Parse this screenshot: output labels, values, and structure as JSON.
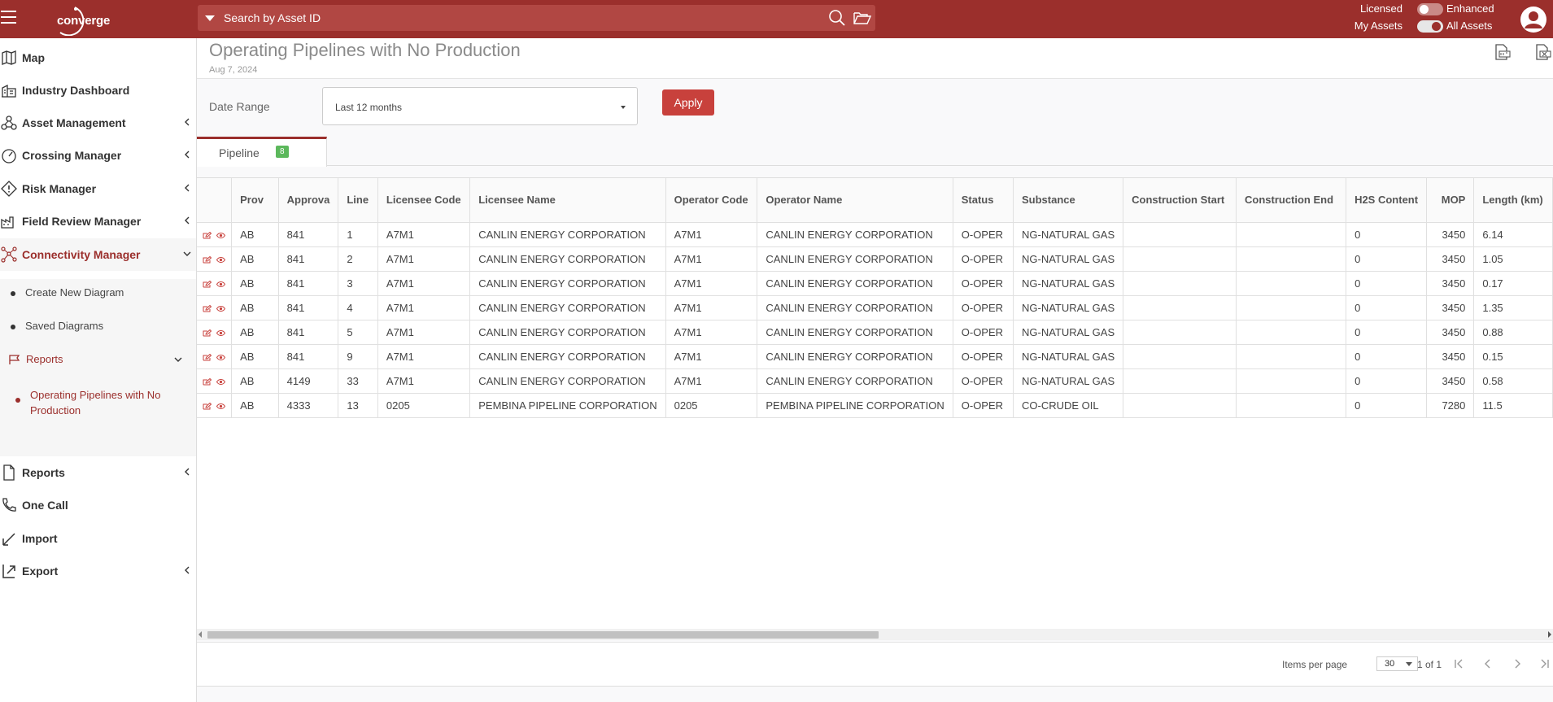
{
  "header": {
    "logo_text": "converge",
    "search_placeholder": "Search by Asset ID",
    "toggle1_left": "Licensed",
    "toggle1_right": "Enhanced",
    "toggle2_left": "My Assets",
    "toggle2_right": "All Assets",
    "accent": "#9b2f2c"
  },
  "sidebar": {
    "map": "Map",
    "industry_dashboard": "Industry Dashboard",
    "asset_management": "Asset Management",
    "crossing_manager": "Crossing Manager",
    "risk_manager": "Risk Manager",
    "field_review_manager": "Field Review Manager",
    "connectivity_manager": "Connectivity Manager",
    "create_new_diagram": "Create New Diagram",
    "saved_diagrams": "Saved Diagrams",
    "reports_sub": "Reports",
    "operating_pipelines": "Operating Pipelines with No Production",
    "reports": "Reports",
    "one_call": "One Call",
    "import": "Import",
    "export": "Export"
  },
  "page": {
    "title": "Operating Pipelines with No Production",
    "date": "Aug 7, 2024",
    "date_range_label": "Date Range",
    "date_range_value": "Last 12 months",
    "apply": "Apply",
    "tab_label": "Pipeline",
    "tab_count": "8"
  },
  "table": {
    "headers": {
      "prov": "Prov",
      "approval": "Approva",
      "line": "Line",
      "licensee_code": "Licensee Code",
      "licensee_name": "Licensee Name",
      "operator_code": "Operator Code",
      "operator_name": "Operator Name",
      "status": "Status",
      "substance": "Substance",
      "construction_start": "Construction Start",
      "construction_end": "Construction End",
      "h2s": "H2S Content",
      "mop": "MOP",
      "length": "Length (km)"
    },
    "rows": [
      {
        "prov": "AB",
        "approval": "841",
        "line": "1",
        "lic_code": "A7M1",
        "lic_name": "CANLIN ENERGY CORPORATION",
        "op_code": "A7M1",
        "op_name": "CANLIN ENERGY CORPORATION",
        "status": "O-OPER",
        "substance": "NG-NATURAL GAS",
        "cstart": "",
        "cend": "",
        "h2s": "0",
        "mop": "3450",
        "length": "6.14"
      },
      {
        "prov": "AB",
        "approval": "841",
        "line": "2",
        "lic_code": "A7M1",
        "lic_name": "CANLIN ENERGY CORPORATION",
        "op_code": "A7M1",
        "op_name": "CANLIN ENERGY CORPORATION",
        "status": "O-OPER",
        "substance": "NG-NATURAL GAS",
        "cstart": "",
        "cend": "",
        "h2s": "0",
        "mop": "3450",
        "length": "1.05"
      },
      {
        "prov": "AB",
        "approval": "841",
        "line": "3",
        "lic_code": "A7M1",
        "lic_name": "CANLIN ENERGY CORPORATION",
        "op_code": "A7M1",
        "op_name": "CANLIN ENERGY CORPORATION",
        "status": "O-OPER",
        "substance": "NG-NATURAL GAS",
        "cstart": "",
        "cend": "",
        "h2s": "0",
        "mop": "3450",
        "length": "0.17"
      },
      {
        "prov": "AB",
        "approval": "841",
        "line": "4",
        "lic_code": "A7M1",
        "lic_name": "CANLIN ENERGY CORPORATION",
        "op_code": "A7M1",
        "op_name": "CANLIN ENERGY CORPORATION",
        "status": "O-OPER",
        "substance": "NG-NATURAL GAS",
        "cstart": "",
        "cend": "",
        "h2s": "0",
        "mop": "3450",
        "length": "1.35"
      },
      {
        "prov": "AB",
        "approval": "841",
        "line": "5",
        "lic_code": "A7M1",
        "lic_name": "CANLIN ENERGY CORPORATION",
        "op_code": "A7M1",
        "op_name": "CANLIN ENERGY CORPORATION",
        "status": "O-OPER",
        "substance": "NG-NATURAL GAS",
        "cstart": "",
        "cend": "",
        "h2s": "0",
        "mop": "3450",
        "length": "0.88"
      },
      {
        "prov": "AB",
        "approval": "841",
        "line": "9",
        "lic_code": "A7M1",
        "lic_name": "CANLIN ENERGY CORPORATION",
        "op_code": "A7M1",
        "op_name": "CANLIN ENERGY CORPORATION",
        "status": "O-OPER",
        "substance": "NG-NATURAL GAS",
        "cstart": "",
        "cend": "",
        "h2s": "0",
        "mop": "3450",
        "length": "0.15"
      },
      {
        "prov": "AB",
        "approval": "4149",
        "line": "33",
        "lic_code": "A7M1",
        "lic_name": "CANLIN ENERGY CORPORATION",
        "op_code": "A7M1",
        "op_name": "CANLIN ENERGY CORPORATION",
        "status": "O-OPER",
        "substance": "NG-NATURAL GAS",
        "cstart": "",
        "cend": "",
        "h2s": "0",
        "mop": "3450",
        "length": "0.58"
      },
      {
        "prov": "AB",
        "approval": "4333",
        "line": "13",
        "lic_code": "0205",
        "lic_name": "PEMBINA PIPELINE CORPORATION",
        "op_code": "0205",
        "op_name": "PEMBINA PIPELINE CORPORATION",
        "status": "O-OPER",
        "substance": "CO-CRUDE OIL",
        "cstart": "",
        "cend": "",
        "h2s": "0",
        "mop": "7280",
        "length": "11.5"
      }
    ]
  },
  "pager": {
    "items_per_page_label": "Items per page",
    "items_per_page": "30",
    "page_info": "1 of 1"
  }
}
